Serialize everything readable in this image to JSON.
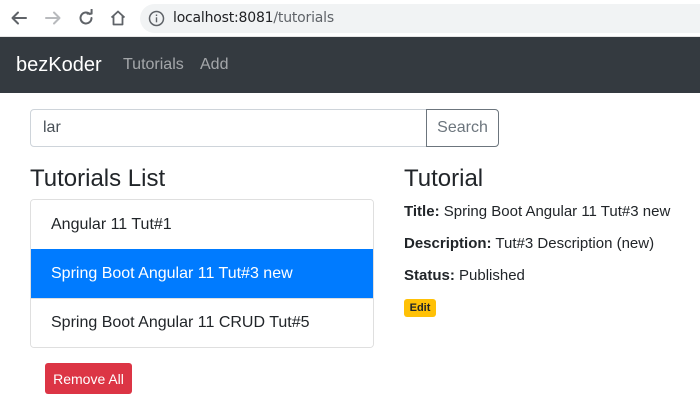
{
  "browser": {
    "url_host": "localhost:8081",
    "url_path": "/tutorials"
  },
  "navbar": {
    "brand": "bezKoder",
    "links": [
      "Tutorials",
      "Add"
    ]
  },
  "search": {
    "value": "lar",
    "button_label": "Search"
  },
  "list": {
    "heading": "Tutorials List",
    "items": [
      "Angular 11 Tut#1",
      "Spring Boot Angular 11 Tut#3 new",
      "Spring Boot Angular 11 CRUD Tut#5"
    ],
    "active_index": 1,
    "remove_all_label": "Remove All"
  },
  "detail": {
    "heading": "Tutorial",
    "title_label": "Title:",
    "title_value": "Spring Boot Angular 11 Tut#3 new",
    "description_label": "Description:",
    "description_value": "Tut#3 Description (new)",
    "status_label": "Status:",
    "status_value": "Published",
    "edit_label": "Edit"
  },
  "colors": {
    "navbar_bg": "#343a40",
    "active_item": "#007bff",
    "danger": "#dc3545",
    "warning": "#ffc107"
  },
  "icons": [
    "back-arrow-icon",
    "forward-arrow-icon",
    "reload-icon",
    "home-icon",
    "info-icon"
  ]
}
